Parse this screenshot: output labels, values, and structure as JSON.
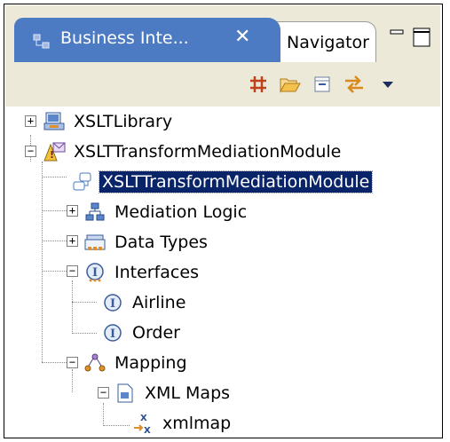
{
  "view": {
    "tabs": [
      {
        "label": "Business Inte...",
        "close": "✕",
        "active": true
      },
      {
        "label": "Navigator",
        "active": false
      }
    ]
  },
  "toolbar": {
    "icons": [
      "link-icon",
      "open-folder-icon",
      "collapse-all-icon",
      "sync-icon",
      "view-menu-icon"
    ]
  },
  "tree": {
    "items": [
      {
        "label": "XSLTLibrary",
        "icon": "library-icon",
        "expand": "+"
      },
      {
        "label": "XSLTTransformMediationModule",
        "icon": "module-icon",
        "expand": "−"
      },
      {
        "label": "XSLTTransformMediationModule",
        "icon": "assembly-icon",
        "selected": true
      },
      {
        "label": "Mediation Logic",
        "icon": "mediation-logic-icon",
        "expand": "+"
      },
      {
        "label": "Data Types",
        "icon": "data-types-icon",
        "expand": "+"
      },
      {
        "label": "Interfaces",
        "icon": "interface-icon",
        "expand": "−"
      },
      {
        "label": "Airline",
        "icon": "interface-icon"
      },
      {
        "label": "Order",
        "icon": "interface-icon"
      },
      {
        "label": "Mapping",
        "icon": "mapping-icon",
        "expand": "−"
      },
      {
        "label": "XML Maps",
        "icon": "xml-maps-icon",
        "expand": "−"
      },
      {
        "label": "xmlmap",
        "icon": "xmlmap-icon"
      }
    ]
  },
  "colors": {
    "active_tab": "#4c7bc4",
    "selection": "#0a246a",
    "chrome": "#ece9d8"
  }
}
